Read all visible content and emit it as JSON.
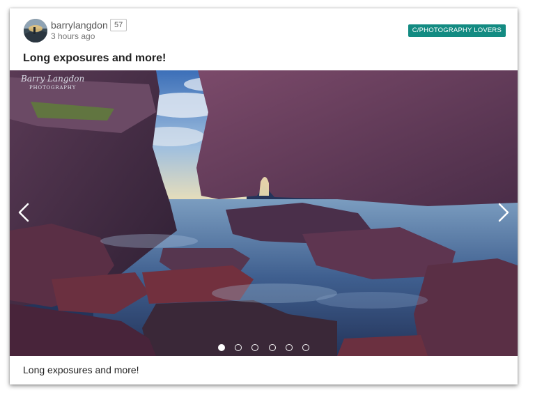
{
  "post": {
    "author": {
      "username": "barrylangdon",
      "reputation": "57",
      "avatar_icon": "user-avatar-icon"
    },
    "timestamp": "3 hours ago",
    "category": "C/PHOTOGRAPHY LOVERS",
    "title": "Long exposures and more!",
    "caption": "Long exposures and more!"
  },
  "carousel": {
    "watermark_name": "Barry Langdon",
    "watermark_sub": "PHOTOGRAPHY",
    "slide_count": 6,
    "active_slide": 1,
    "prev_icon": "chevron-left-icon",
    "next_icon": "chevron-right-icon"
  },
  "colors": {
    "category_badge_bg": "#138b82",
    "badge_text": "#ffffff"
  }
}
